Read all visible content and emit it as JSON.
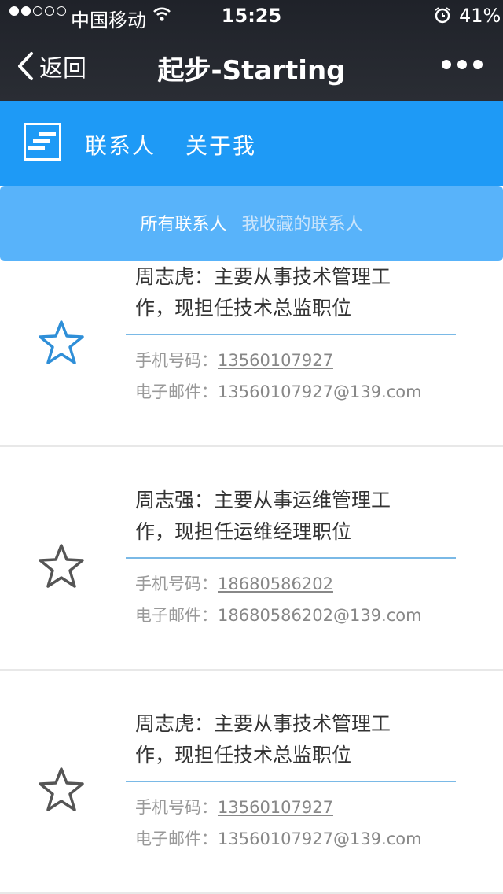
{
  "status_bar": {
    "carrier": "中国移动",
    "time": "15:25",
    "battery": "41%"
  },
  "nav": {
    "back_label": "返回",
    "title": "起步-Starting"
  },
  "header": {
    "links": [
      "联系人",
      "关于我"
    ]
  },
  "filter": {
    "all": "所有联系人",
    "favorites": "我收藏的联系人"
  },
  "labels": {
    "phone": "手机号码：",
    "email": "电子邮件："
  },
  "contacts": [
    {
      "desc_line1": "周志虎：主要从事技术管理工",
      "desc_line2": "作，现担任技术总监职位",
      "phone": "13560107927",
      "email": "13560107927@139.com",
      "favorited": true
    },
    {
      "desc_line1": "周志强：主要从事运维管理工",
      "desc_line2": "作，现担任运维经理职位",
      "phone": "18680586202",
      "email": "18680586202@139.com",
      "favorited": false
    },
    {
      "desc_line1": "周志虎：主要从事技术管理工",
      "desc_line2": "作，现担任技术总监职位",
      "phone": "13560107927",
      "email": "13560107927@139.com",
      "favorited": false
    }
  ],
  "colors": {
    "nav_bg": "#23262d",
    "header_blue": "#1e9af6",
    "filter_blue": "#58b3fa",
    "star_active": "#2f8fd8",
    "star_inactive": "#555555"
  }
}
